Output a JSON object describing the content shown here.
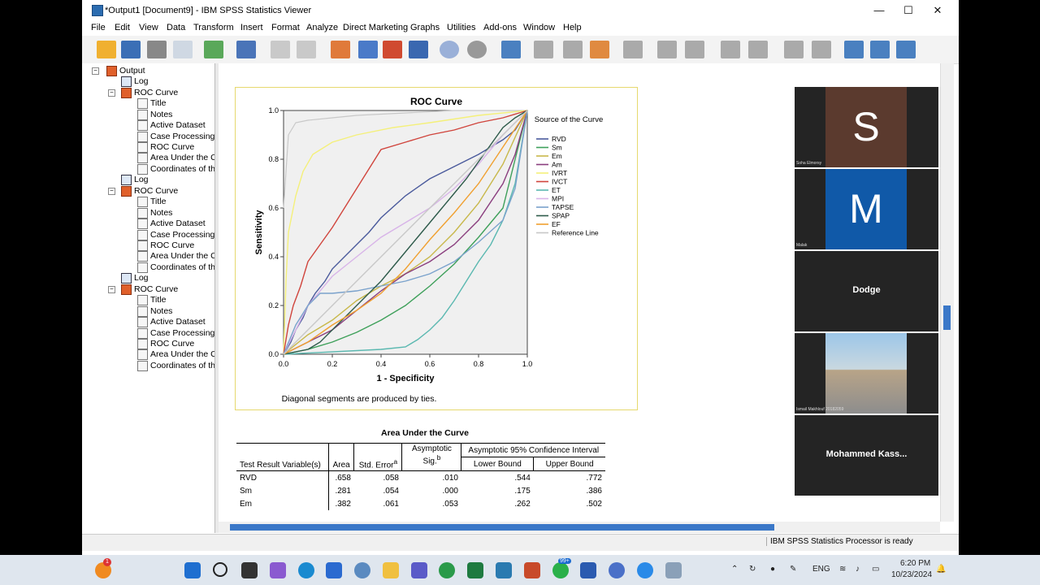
{
  "window": {
    "title": "*Output1 [Document9] - IBM SPSS Statistics Viewer",
    "minimize": "—",
    "maximize": "☐",
    "close": "✕"
  },
  "menu": [
    "File",
    "Edit",
    "View",
    "Data",
    "Transform",
    "Insert",
    "Format",
    "Analyze",
    "Direct Marketing",
    "Graphs",
    "Utilities",
    "Add-ons",
    "Window",
    "Help"
  ],
  "tree": {
    "root": "Output",
    "groups": [
      {
        "log": "Log",
        "proc": "ROC Curve",
        "items": [
          "Title",
          "Notes",
          "Active Dataset",
          "Case Processing",
          "ROC Curve",
          "Area Under the Cu",
          "Coordinates of the"
        ]
      },
      {
        "log": "Log",
        "proc": "ROC Curve",
        "items": [
          "Title",
          "Notes",
          "Active Dataset",
          "Case Processing",
          "ROC Curve",
          "Area Under the Cu",
          "Coordinates of the"
        ]
      },
      {
        "log": "Log",
        "proc": "ROC Curve",
        "items": [
          "Title",
          "Notes",
          "Active Dataset",
          "Case Processing",
          "ROC Curve",
          "Area Under the Cu",
          "Coordinates of the"
        ]
      }
    ]
  },
  "chart_data": {
    "type": "line",
    "title": "ROC Curve",
    "xlabel": "1 - Specificity",
    "ylabel": "Sensitivity",
    "xlim": [
      0,
      1
    ],
    "ylim": [
      0,
      1
    ],
    "xticks": [
      "0.0",
      "0.2",
      "0.4",
      "0.6",
      "0.8",
      "1.0"
    ],
    "yticks": [
      "0.0",
      "0.2",
      "0.4",
      "0.6",
      "0.8",
      "1.0"
    ],
    "legend_title": "Source of the Curve",
    "legend_position": "right",
    "footnote": "Diagonal segments are produced by ties.",
    "series": [
      {
        "name": "RVD",
        "color": "#4a5a9c",
        "x": [
          0,
          0.03,
          0.05,
          0.08,
          0.1,
          0.13,
          0.17,
          0.2,
          0.25,
          0.3,
          0.35,
          0.4,
          0.5,
          0.6,
          0.7,
          0.8,
          0.9,
          0.95,
          1
        ],
        "y": [
          0,
          0.05,
          0.1,
          0.15,
          0.2,
          0.25,
          0.3,
          0.35,
          0.4,
          0.45,
          0.5,
          0.56,
          0.65,
          0.72,
          0.77,
          0.82,
          0.88,
          0.92,
          1
        ]
      },
      {
        "name": "Sm",
        "color": "#3ea05a",
        "x": [
          0,
          0.1,
          0.2,
          0.3,
          0.4,
          0.5,
          0.6,
          0.7,
          0.8,
          0.9,
          0.95,
          1
        ],
        "y": [
          0,
          0.02,
          0.05,
          0.09,
          0.14,
          0.2,
          0.28,
          0.37,
          0.48,
          0.6,
          0.8,
          1
        ]
      },
      {
        "name": "Em",
        "color": "#c8b84a",
        "x": [
          0,
          0.1,
          0.2,
          0.3,
          0.4,
          0.5,
          0.6,
          0.7,
          0.8,
          0.9,
          1
        ],
        "y": [
          0,
          0.08,
          0.14,
          0.22,
          0.28,
          0.33,
          0.4,
          0.5,
          0.62,
          0.78,
          1
        ]
      },
      {
        "name": "Am",
        "color": "#8a3e7e",
        "x": [
          0,
          0.1,
          0.2,
          0.3,
          0.4,
          0.5,
          0.6,
          0.7,
          0.8,
          0.9,
          0.95,
          1
        ],
        "y": [
          0,
          0.05,
          0.1,
          0.18,
          0.26,
          0.33,
          0.38,
          0.45,
          0.55,
          0.7,
          0.82,
          1
        ]
      },
      {
        "name": "IVRT",
        "color": "#f4f07a",
        "x": [
          0,
          0.01,
          0.02,
          0.05,
          0.08,
          0.12,
          0.2,
          0.3,
          0.45,
          0.6,
          0.8,
          1
        ],
        "y": [
          0,
          0.3,
          0.5,
          0.65,
          0.75,
          0.82,
          0.87,
          0.9,
          0.93,
          0.95,
          0.98,
          1
        ]
      },
      {
        "name": "IVCT",
        "color": "#d0443c",
        "x": [
          0,
          0.02,
          0.04,
          0.07,
          0.1,
          0.15,
          0.2,
          0.25,
          0.3,
          0.35,
          0.4,
          0.5,
          0.6,
          0.7,
          0.8,
          0.9,
          1
        ],
        "y": [
          0,
          0.12,
          0.2,
          0.28,
          0.38,
          0.45,
          0.52,
          0.6,
          0.68,
          0.76,
          0.84,
          0.87,
          0.9,
          0.92,
          0.95,
          0.97,
          1
        ]
      },
      {
        "name": "ET",
        "color": "#5ab8b0",
        "x": [
          0,
          0.4,
          0.5,
          0.55,
          0.6,
          0.65,
          0.7,
          0.75,
          0.8,
          0.85,
          0.9,
          0.95,
          1
        ],
        "y": [
          0,
          0.02,
          0.03,
          0.06,
          0.1,
          0.15,
          0.22,
          0.3,
          0.38,
          0.45,
          0.55,
          0.7,
          1
        ]
      },
      {
        "name": "MPI",
        "color": "#d8b4e8",
        "x": [
          0,
          0.05,
          0.1,
          0.2,
          0.3,
          0.4,
          0.5,
          0.6,
          0.7,
          0.8,
          0.9,
          1
        ],
        "y": [
          0,
          0.1,
          0.2,
          0.32,
          0.4,
          0.48,
          0.54,
          0.6,
          0.68,
          0.78,
          0.9,
          1
        ]
      },
      {
        "name": "TAPSE",
        "color": "#7aa2cc",
        "x": [
          0,
          0.05,
          0.1,
          0.15,
          0.2,
          0.3,
          0.4,
          0.5,
          0.6,
          0.7,
          0.8,
          0.9,
          0.95,
          1
        ],
        "y": [
          0,
          0.12,
          0.2,
          0.25,
          0.25,
          0.26,
          0.28,
          0.3,
          0.33,
          0.38,
          0.46,
          0.55,
          0.68,
          1
        ]
      },
      {
        "name": "SPAP",
        "color": "#2d5a4a",
        "x": [
          0,
          0.1,
          0.15,
          0.2,
          0.25,
          0.3,
          0.35,
          0.4,
          0.45,
          0.5,
          0.55,
          0.6,
          0.65,
          0.7,
          0.75,
          0.8,
          0.85,
          0.9,
          0.95,
          1
        ],
        "y": [
          0,
          0.02,
          0.05,
          0.1,
          0.15,
          0.2,
          0.25,
          0.3,
          0.36,
          0.42,
          0.48,
          0.54,
          0.6,
          0.66,
          0.72,
          0.79,
          0.86,
          0.93,
          0.97,
          1
        ]
      },
      {
        "name": "EF",
        "color": "#f0a030",
        "x": [
          0,
          0.1,
          0.2,
          0.3,
          0.4,
          0.5,
          0.6,
          0.7,
          0.8,
          0.9,
          1
        ],
        "y": [
          0,
          0.05,
          0.12,
          0.18,
          0.25,
          0.35,
          0.47,
          0.58,
          0.7,
          0.85,
          1
        ]
      },
      {
        "name": "Reference Line",
        "color": "#c8c8c8",
        "x": [
          0,
          1
        ],
        "y": [
          0,
          1
        ]
      }
    ],
    "grey_line": {
      "x": [
        0,
        0.02,
        0.05,
        0.1,
        0.2,
        0.3,
        0.5,
        0.7,
        1
      ],
      "y": [
        0.6,
        0.9,
        0.95,
        0.96,
        0.97,
        0.98,
        0.99,
        1,
        1
      ]
    }
  },
  "auc_table": {
    "title": "Area Under the Curve",
    "headers": {
      "var": "Test Result Variable(s)",
      "area": "Area",
      "se": "Std. Error",
      "se_sup": "a",
      "sig": "Asymptotic Sig.",
      "sig_sup": "b",
      "ci": "Asymptotic 95% Confidence Interval",
      "lower": "Lower Bound",
      "upper": "Upper Bound"
    },
    "rows": [
      {
        "var": "RVD",
        "area": ".658",
        "se": ".058",
        "sig": ".010",
        "lower": ".544",
        "upper": ".772"
      },
      {
        "var": "Sm",
        "area": ".281",
        "se": ".054",
        "sig": ".000",
        "lower": ".175",
        "upper": ".386"
      },
      {
        "var": "Em",
        "area": ".382",
        "se": ".061",
        "sig": ".053",
        "lower": ".262",
        "upper": ".502"
      }
    ]
  },
  "status": {
    "processor": "IBM SPSS Statistics Processor is ready"
  },
  "participants": [
    {
      "initial": "S",
      "name": "Soha Elmorsy",
      "bg": "#5b3a2e"
    },
    {
      "initial": "M",
      "name": "Malak",
      "bg": "#1059a8"
    },
    {
      "label": "Dodge"
    },
    {
      "name": "Ismail Makhlouf 20182059"
    },
    {
      "label": "Mohammed  Kass..."
    }
  ],
  "taskbar": {
    "lang": "ENG",
    "time": "6:20 PM",
    "date": "10/23/2024",
    "badge1": "1",
    "badge2": "99+"
  }
}
